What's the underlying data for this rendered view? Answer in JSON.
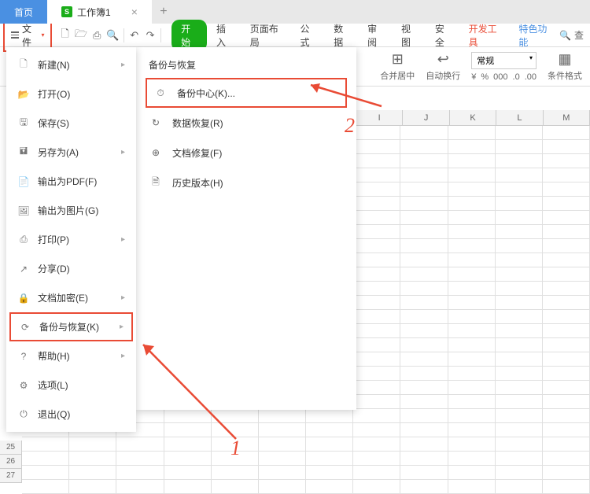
{
  "tabs": {
    "home": "首页",
    "workbook": "工作簿1"
  },
  "file_btn": "文件",
  "ribbon": {
    "start": "开始",
    "insert": "插入",
    "layout": "页面布局",
    "formula": "公式",
    "data": "数据",
    "review": "审阅",
    "view": "视图",
    "security": "安全",
    "dev": "开发工具",
    "special": "特色功能",
    "search": "查"
  },
  "toolbar2": {
    "merge": "合并居中",
    "wrap": "自动换行",
    "general": "常规",
    "condfmt": "条件格式"
  },
  "numfmt_icons": [
    "¥",
    "%",
    "000",
    ".0",
    ".00"
  ],
  "file_menu": [
    {
      "label": "新建(N)",
      "arrow": true,
      "icon": "doc"
    },
    {
      "label": "打开(O)",
      "arrow": false,
      "icon": "folder"
    },
    {
      "label": "保存(S)",
      "arrow": false,
      "icon": "save"
    },
    {
      "label": "另存为(A)",
      "arrow": true,
      "icon": "saveas"
    },
    {
      "label": "输出为PDF(F)",
      "arrow": false,
      "icon": "pdf"
    },
    {
      "label": "输出为图片(G)",
      "arrow": false,
      "icon": "img"
    },
    {
      "label": "打印(P)",
      "arrow": true,
      "icon": "print"
    },
    {
      "label": "分享(D)",
      "arrow": false,
      "icon": "share"
    },
    {
      "label": "文档加密(E)",
      "arrow": true,
      "icon": "lock"
    },
    {
      "label": "备份与恢复(K)",
      "arrow": true,
      "icon": "backup",
      "highlighted": true
    },
    {
      "label": "帮助(H)",
      "arrow": true,
      "icon": "help"
    },
    {
      "label": "选项(L)",
      "arrow": false,
      "icon": "opts"
    },
    {
      "label": "退出(Q)",
      "arrow": false,
      "icon": "exit"
    }
  ],
  "submenu": {
    "title": "备份与恢复",
    "items": [
      {
        "label": "备份中心(K)...",
        "boxed": true
      },
      {
        "label": "数据恢复(R)"
      },
      {
        "label": "文档修复(F)"
      },
      {
        "label": "历史版本(H)"
      }
    ]
  },
  "cols": [
    "I",
    "J",
    "K",
    "L",
    "M"
  ],
  "rows": [
    "25",
    "26",
    "27"
  ],
  "anno": {
    "one": "1",
    "two": "2"
  }
}
